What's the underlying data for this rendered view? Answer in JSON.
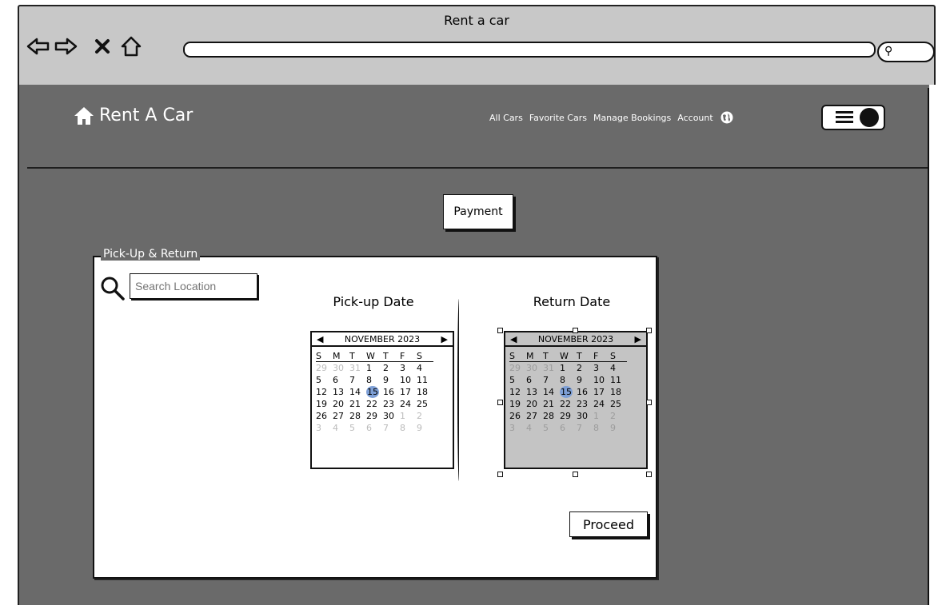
{
  "window": {
    "title": "Rent a car"
  },
  "browser": {
    "back_icon": "arrow-left-icon",
    "forward_icon": "arrow-right-icon",
    "stop_icon": "close-icon",
    "home_icon": "home-icon",
    "search_icon": "magnifier-icon",
    "url": ""
  },
  "header": {
    "brand": "Rent A Car",
    "brand_icon": "home-icon",
    "nav": [
      "All Cars",
      "Favorite Cars",
      "Manage Bookings",
      "Account"
    ],
    "globe_icon": "globe-icon",
    "menu_icon": "hamburger-toggle-icon"
  },
  "payment_label": "Payment",
  "panel": {
    "legend": "Pick-Up & Return",
    "search_placeholder": "Search Location",
    "pickup_title": "Pick-up Date",
    "return_title": "Return Date",
    "proceed_label": "Proceed"
  },
  "calendar": {
    "month_label": "NOVEMBER 2023",
    "weekdays": [
      "S",
      "M",
      "T",
      "W",
      "T",
      "F",
      "S"
    ],
    "days": [
      [
        "29",
        "30",
        "31",
        "1",
        "2",
        "3",
        "4"
      ],
      [
        "5",
        "6",
        "7",
        "8",
        "9",
        "10",
        "11"
      ],
      [
        "12",
        "13",
        "14",
        "15",
        "16",
        "17",
        "18"
      ],
      [
        "19",
        "20",
        "21",
        "22",
        "23",
        "24",
        "25"
      ],
      [
        "26",
        "27",
        "28",
        "29",
        "30",
        "1",
        "2"
      ],
      [
        "3",
        "4",
        "5",
        "6",
        "7",
        "8",
        "9"
      ]
    ],
    "outside_month": [
      [
        0,
        0
      ],
      [
        0,
        1
      ],
      [
        0,
        2
      ],
      [
        4,
        5
      ],
      [
        4,
        6
      ],
      [
        5,
        0
      ],
      [
        5,
        1
      ],
      [
        5,
        2
      ],
      [
        5,
        3
      ],
      [
        5,
        4
      ],
      [
        5,
        5
      ],
      [
        5,
        6
      ]
    ],
    "highlighted_day": "15"
  },
  "colors": {
    "app_bg": "#6a6a6a",
    "chrome_bg": "#c8c8c8",
    "highlight": "#7d9fd6"
  }
}
